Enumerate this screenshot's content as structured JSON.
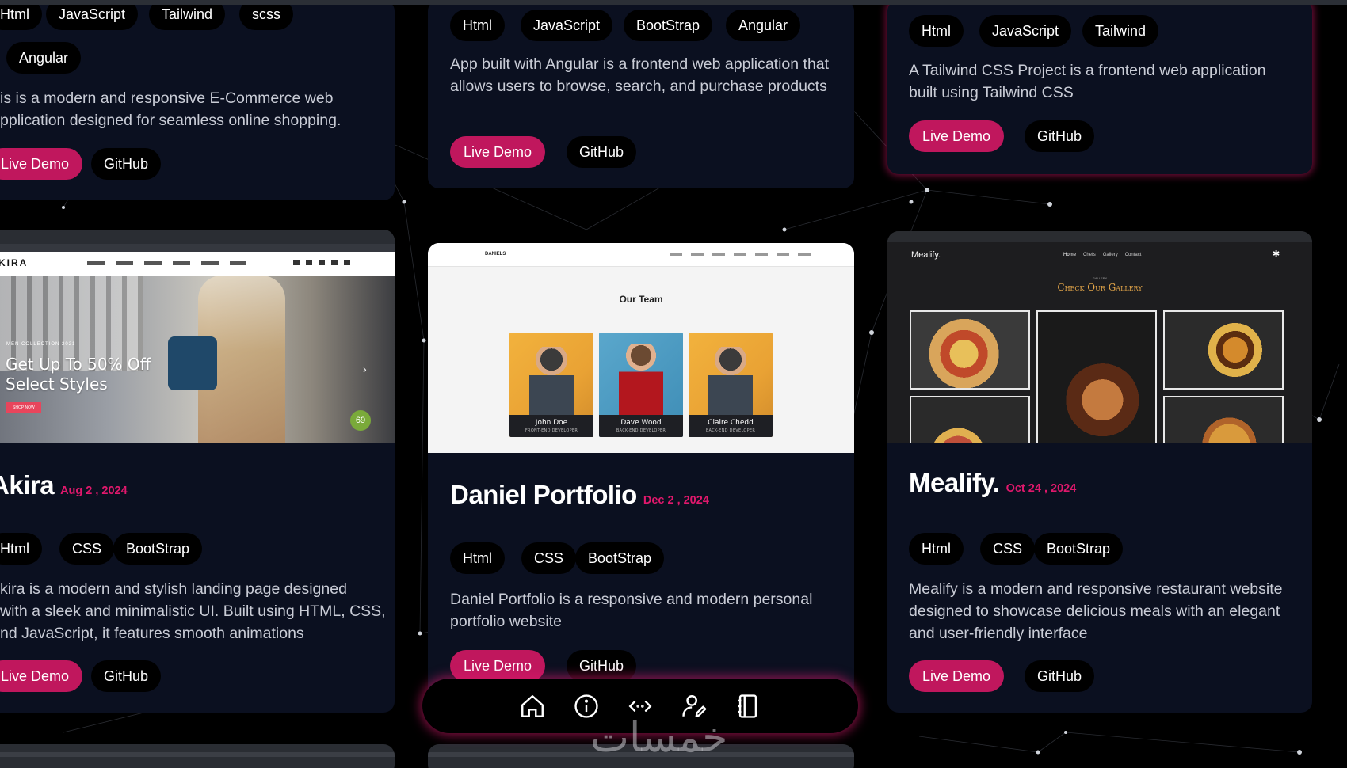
{
  "cards": {
    "top_left": {
      "tags": [
        "Html",
        "JavaScript",
        "Tailwind",
        "scss",
        "Angular"
      ],
      "description": "is is a modern and responsive E-Commerce web\npplication designed for seamless online shopping.",
      "live_label": "Live Demo",
      "github_label": "GitHub"
    },
    "top_mid": {
      "tags": [
        "Html",
        "JavaScript",
        "BootStrap",
        "Angular"
      ],
      "description": "App built with Angular is a frontend web application that allows users to browse, search, and purchase products",
      "live_label": "Live Demo",
      "github_label": "GitHub"
    },
    "top_right": {
      "tags": [
        "Html",
        "JavaScript",
        "Tailwind"
      ],
      "description": "A Tailwind CSS Project is a frontend web application built using Tailwind CSS",
      "live_label": "Live Demo",
      "github_label": "GitHub"
    },
    "akira": {
      "title": "Akira",
      "date": "Aug 2 , 2024",
      "tags": [
        "Html",
        "CSS",
        "BootStrap"
      ],
      "description": "kira is a modern and stylish landing page designed\nwith a sleek and minimalistic UI. Built using HTML, CSS,\nnd JavaScript, it features smooth animations",
      "live_label": "Live Demo",
      "github_label": "GitHub",
      "screenshot": {
        "brand": "KIRA",
        "kicker": "MEN COLLECTION 2021",
        "headline_1": "Get Up To 50% Off",
        "headline_2": "Select Styles",
        "cta": "SHOP NOW",
        "badge": "69"
      }
    },
    "daniel": {
      "title": "Daniel Portfolio",
      "date": "Dec 2 , 2024",
      "tags": [
        "Html",
        "CSS",
        "BootStrap"
      ],
      "description": "Daniel Portfolio is a responsive and modern personal portfolio website",
      "live_label": "Live Demo",
      "github_label": "GitHub",
      "screenshot": {
        "brand": "DANIELS",
        "nav": [
          "Home",
          "About",
          "Services",
          "Works",
          "Clients",
          "Team",
          "Contact"
        ],
        "heading": "Our Team",
        "members": [
          {
            "name": "John Doe",
            "role": "FRONT-END DEVELOPER"
          },
          {
            "name": "Dave Wood",
            "role": "BACK-END DEVELOPER"
          },
          {
            "name": "Claire Chedd",
            "role": "BACK-END DEVELOPER"
          }
        ]
      }
    },
    "mealify": {
      "title": "Mealify.",
      "date": "Oct 24 , 2024",
      "tags": [
        "Html",
        "CSS",
        "BootStrap"
      ],
      "description": "Mealify is a modern and responsive restaurant website designed to showcase delicious meals with an elegant and user-friendly interface",
      "live_label": "Live Demo",
      "github_label": "GitHub",
      "screenshot": {
        "brand": "Mealify.",
        "nav": [
          "Home",
          "Chefs",
          "Gallery",
          "Contact"
        ],
        "kicker": "GALLERY",
        "heading": "Check Our Gallery"
      }
    }
  },
  "bottom_nav": {
    "items": [
      {
        "icon": "home-icon"
      },
      {
        "icon": "info-icon"
      },
      {
        "icon": "code-icon"
      },
      {
        "icon": "user-edit-icon"
      },
      {
        "icon": "notebook-icon"
      }
    ]
  },
  "watermark": "خمسات",
  "colors": {
    "accent": "#c0175d",
    "date": "#e0186c",
    "card_bg": "#0b1020",
    "page_bg": "#000000"
  }
}
